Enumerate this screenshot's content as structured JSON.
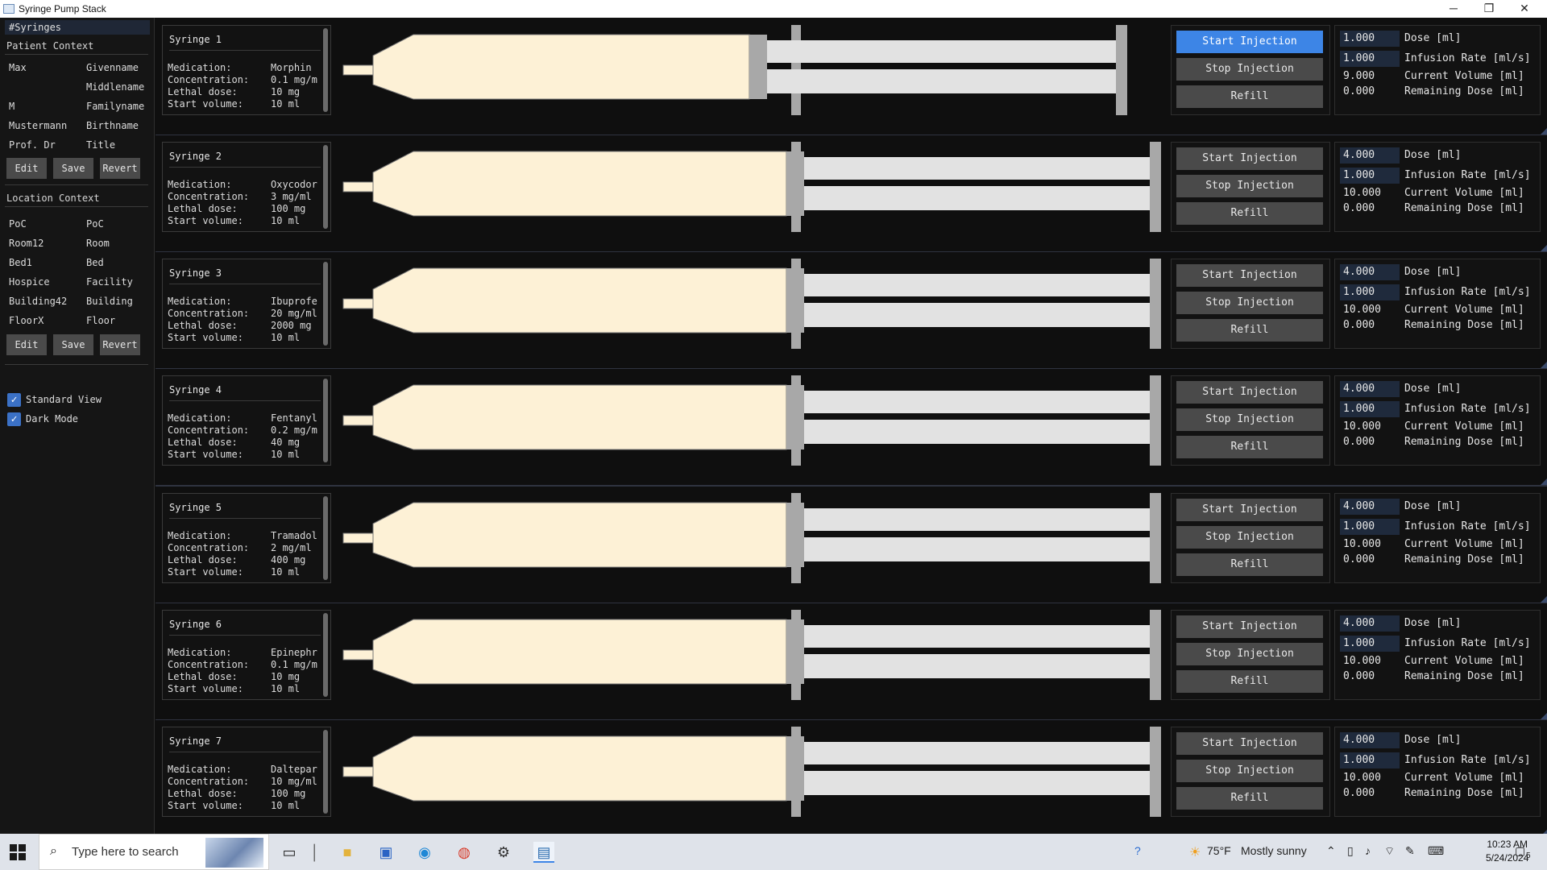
{
  "window": {
    "title": "Syringe Pump Stack",
    "minimize_glyph": "─",
    "restore_glyph": "❐",
    "close_glyph": "✕"
  },
  "sidebar": {
    "tab_label": "#Syringes",
    "patient_context": {
      "title": "Patient Context",
      "rows": [
        {
          "value": "Max",
          "label": "Givenname"
        },
        {
          "value": "",
          "label": "Middlename"
        },
        {
          "value": "M",
          "label": "Familyname"
        },
        {
          "value": "Mustermann",
          "label": "Birthname"
        },
        {
          "value": "Prof. Dr",
          "label": "Title"
        }
      ],
      "buttons": {
        "edit": "Edit",
        "save": "Save",
        "revert": "Revert"
      }
    },
    "location_context": {
      "title": "Location Context",
      "rows": [
        {
          "value": "PoC",
          "label": "PoC"
        },
        {
          "value": "Room12",
          "label": "Room"
        },
        {
          "value": "Bed1",
          "label": "Bed"
        },
        {
          "value": "Hospice",
          "label": "Facility"
        },
        {
          "value": "Building42",
          "label": "Building"
        },
        {
          "value": "FloorX",
          "label": "Floor"
        }
      ],
      "buttons": {
        "edit": "Edit",
        "save": "Save",
        "revert": "Revert"
      }
    },
    "checkboxes": [
      {
        "label": "Standard View",
        "checked": true
      },
      {
        "label": "Dark Mode",
        "checked": true
      }
    ],
    "check_glyph": "✓"
  },
  "labels": {
    "medication": "Medication:",
    "concentration": "Concentration:",
    "lethal_dose": "Lethal dose:",
    "start_volume": "Start volume:",
    "start_button": "Start Injection",
    "stop_button": "Stop Injection",
    "refill_button": "Refill",
    "dose": "Dose [ml]",
    "infusion_rate": "Infusion Rate [ml/s]",
    "current_volume": "Current Volume [ml]",
    "remaining_dose": "Remaining Dose [ml]"
  },
  "syringes": [
    {
      "name": "Syringe 1",
      "medication": "Morphin",
      "concentration": "0.1 mg/m",
      "lethal_dose": "10 mg",
      "start_volume": "10 ml",
      "dose": "1.000",
      "infusion_rate": "1.000",
      "current_volume": "9.000",
      "remaining_dose": "0.000",
      "fill_fraction": 0.9,
      "active": true
    },
    {
      "name": "Syringe 2",
      "medication": "Oxycodor",
      "concentration": "3 mg/ml",
      "lethal_dose": "100 mg",
      "start_volume": "10 ml",
      "dose": "4.000",
      "infusion_rate": "1.000",
      "current_volume": "10.000",
      "remaining_dose": "0.000",
      "fill_fraction": 1.0,
      "active": false
    },
    {
      "name": "Syringe 3",
      "medication": "Ibuprofe",
      "concentration": "20 mg/ml",
      "lethal_dose": "2000 mg",
      "start_volume": "10 ml",
      "dose": "4.000",
      "infusion_rate": "1.000",
      "current_volume": "10.000",
      "remaining_dose": "0.000",
      "fill_fraction": 1.0,
      "active": false
    },
    {
      "name": "Syringe 4",
      "medication": "Fentanyl",
      "concentration": "0.2 mg/m",
      "lethal_dose": "40 mg",
      "start_volume": "10 ml",
      "dose": "4.000",
      "infusion_rate": "1.000",
      "current_volume": "10.000",
      "remaining_dose": "0.000",
      "fill_fraction": 1.0,
      "active": false
    },
    {
      "name": "Syringe 5",
      "medication": "Tramadol",
      "concentration": "2 mg/ml",
      "lethal_dose": "400 mg",
      "start_volume": "10 ml",
      "dose": "4.000",
      "infusion_rate": "1.000",
      "current_volume": "10.000",
      "remaining_dose": "0.000",
      "fill_fraction": 1.0,
      "active": false
    },
    {
      "name": "Syringe 6",
      "medication": "Epinephr",
      "concentration": "0.1 mg/m",
      "lethal_dose": "10 mg",
      "start_volume": "10 ml",
      "dose": "4.000",
      "infusion_rate": "1.000",
      "current_volume": "10.000",
      "remaining_dose": "0.000",
      "fill_fraction": 1.0,
      "active": false
    },
    {
      "name": "Syringe 7",
      "medication": "Daltepar",
      "concentration": "10 mg/ml",
      "lethal_dose": "100 mg",
      "start_volume": "10 ml",
      "dose": "4.000",
      "infusion_rate": "1.000",
      "current_volume": "10.000",
      "remaining_dose": "0.000",
      "fill_fraction": 1.0,
      "active": false
    }
  ],
  "colors": {
    "fluid": "#fdf1d6",
    "plunger": "#a8a8a8",
    "barrel_empty": "#e2e2e2",
    "active_button": "#3d85e6",
    "button": "#4a4a4a",
    "value_box": "#1f2a3c"
  },
  "taskbar": {
    "search_placeholder": "Type here to search",
    "weather_temp": "75°F",
    "weather_text": "Mostly sunny",
    "time": "10:23 AM",
    "date": "5/24/2024",
    "notification_count": "5",
    "icons": [
      "windows-start-icon",
      "search-icon",
      "task-view-icon",
      "file-explorer-icon",
      "store-icon",
      "edge-icon",
      "chrome-icon",
      "settings-icon",
      "syringe-app-icon"
    ]
  }
}
